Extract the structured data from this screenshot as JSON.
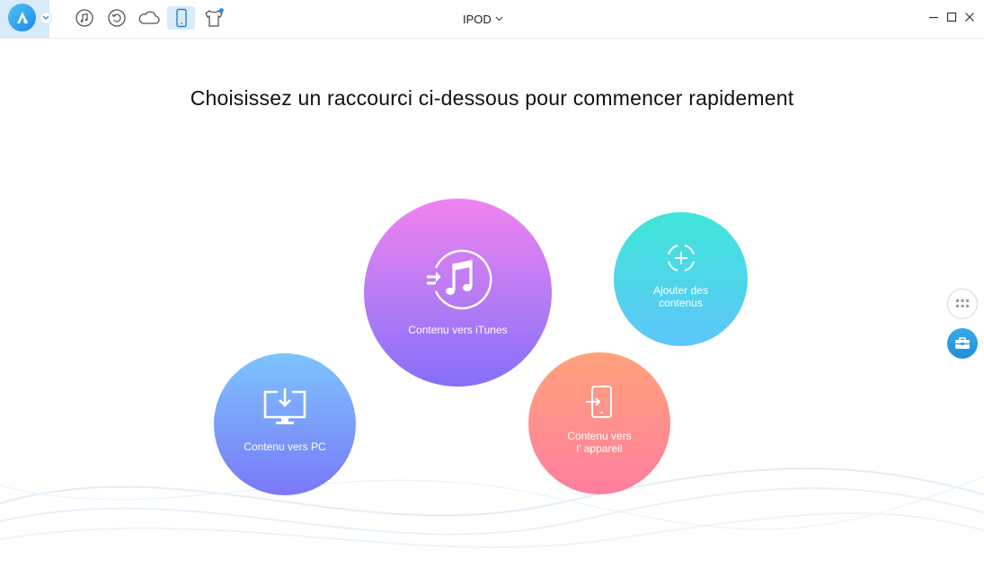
{
  "header": {
    "device_name": "IPOD",
    "tools": [
      {
        "name": "music-icon"
      },
      {
        "name": "restore-icon"
      },
      {
        "name": "cloud-icon"
      },
      {
        "name": "device-icon",
        "active": true
      },
      {
        "name": "tshirt-icon",
        "badge": true
      }
    ],
    "window_controls": [
      "minimize-icon",
      "maximize-icon",
      "close-icon"
    ]
  },
  "main": {
    "headline": "Choisissez un raccourci ci-dessous pour commencer rapidement",
    "shortcuts": {
      "itunes": {
        "label": "Contenu vers iTunes",
        "icon": "transfer-to-music-icon"
      },
      "add": {
        "label": "Ajouter des\ncontenus",
        "icon": "add-content-icon"
      },
      "pc": {
        "label": "Contenu vers PC",
        "icon": "monitor-download-icon"
      },
      "device": {
        "label": "Contenu vers\nl’ appareil",
        "icon": "phone-import-icon"
      }
    }
  },
  "sidebar_right": {
    "buttons": [
      {
        "name": "grid-icon"
      },
      {
        "name": "toolbox-icon"
      }
    ]
  },
  "colors": {
    "accent": "#1f8fd9",
    "itunes_top": "#f083f0",
    "itunes_bottom": "#8470fb",
    "add_top": "#3fe6d9",
    "add_bottom": "#5ec6fa",
    "pc_top": "#7cc4fc",
    "pc_bottom": "#7a78f9",
    "device_top": "#ffa27a",
    "device_bottom": "#ff7ea0"
  }
}
